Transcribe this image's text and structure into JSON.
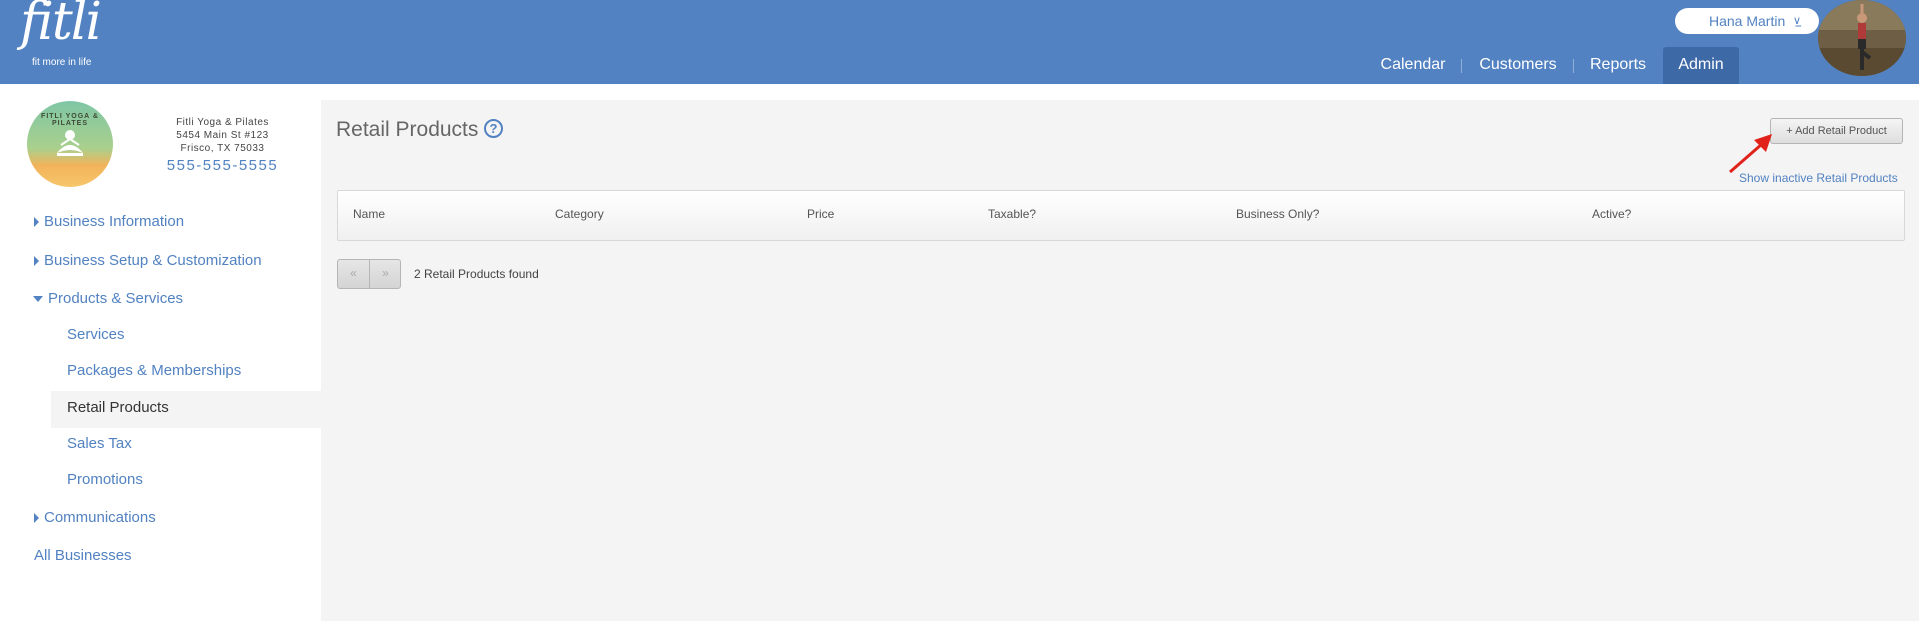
{
  "brand": {
    "name": "fitli",
    "tagline": "fit more in life",
    "header_color": "#5282c1"
  },
  "user": {
    "name": "Hana Martin",
    "menu_icon": "chevron-double-down-icon"
  },
  "nav": {
    "calendar": "Calendar",
    "customers": "Customers",
    "reports": "Reports",
    "admin": "Admin",
    "active": "Admin"
  },
  "business": {
    "logo_text": "FITLI YOGA & PILATES",
    "name": "Fitli Yoga & Pilates",
    "address1": "5454 Main St #123",
    "address2": "Frisco, TX 75033",
    "phone": "555-555-5555"
  },
  "sidebar": {
    "business_information": "Business Information",
    "business_setup": "Business Setup & Customization",
    "products_services": "Products & Services",
    "services": "Services",
    "packages": "Packages & Memberships",
    "retail_products": "Retail Products",
    "sales_tax": "Sales Tax",
    "promotions": "Promotions",
    "communications": "Communications",
    "all_businesses": "All Businesses"
  },
  "main": {
    "title": "Retail Products",
    "help_icon_glyph": "?",
    "add_button": "+ Add Retail Product",
    "show_inactive": "Show inactive Retail Products",
    "columns": {
      "name": "Name",
      "category": "Category",
      "price": "Price",
      "taxable": "Taxable?",
      "business_only": "Business Only?",
      "active": "Active?"
    },
    "pager": {
      "prev": "«",
      "next": "»"
    },
    "found_text": "2 Retail Products found"
  }
}
